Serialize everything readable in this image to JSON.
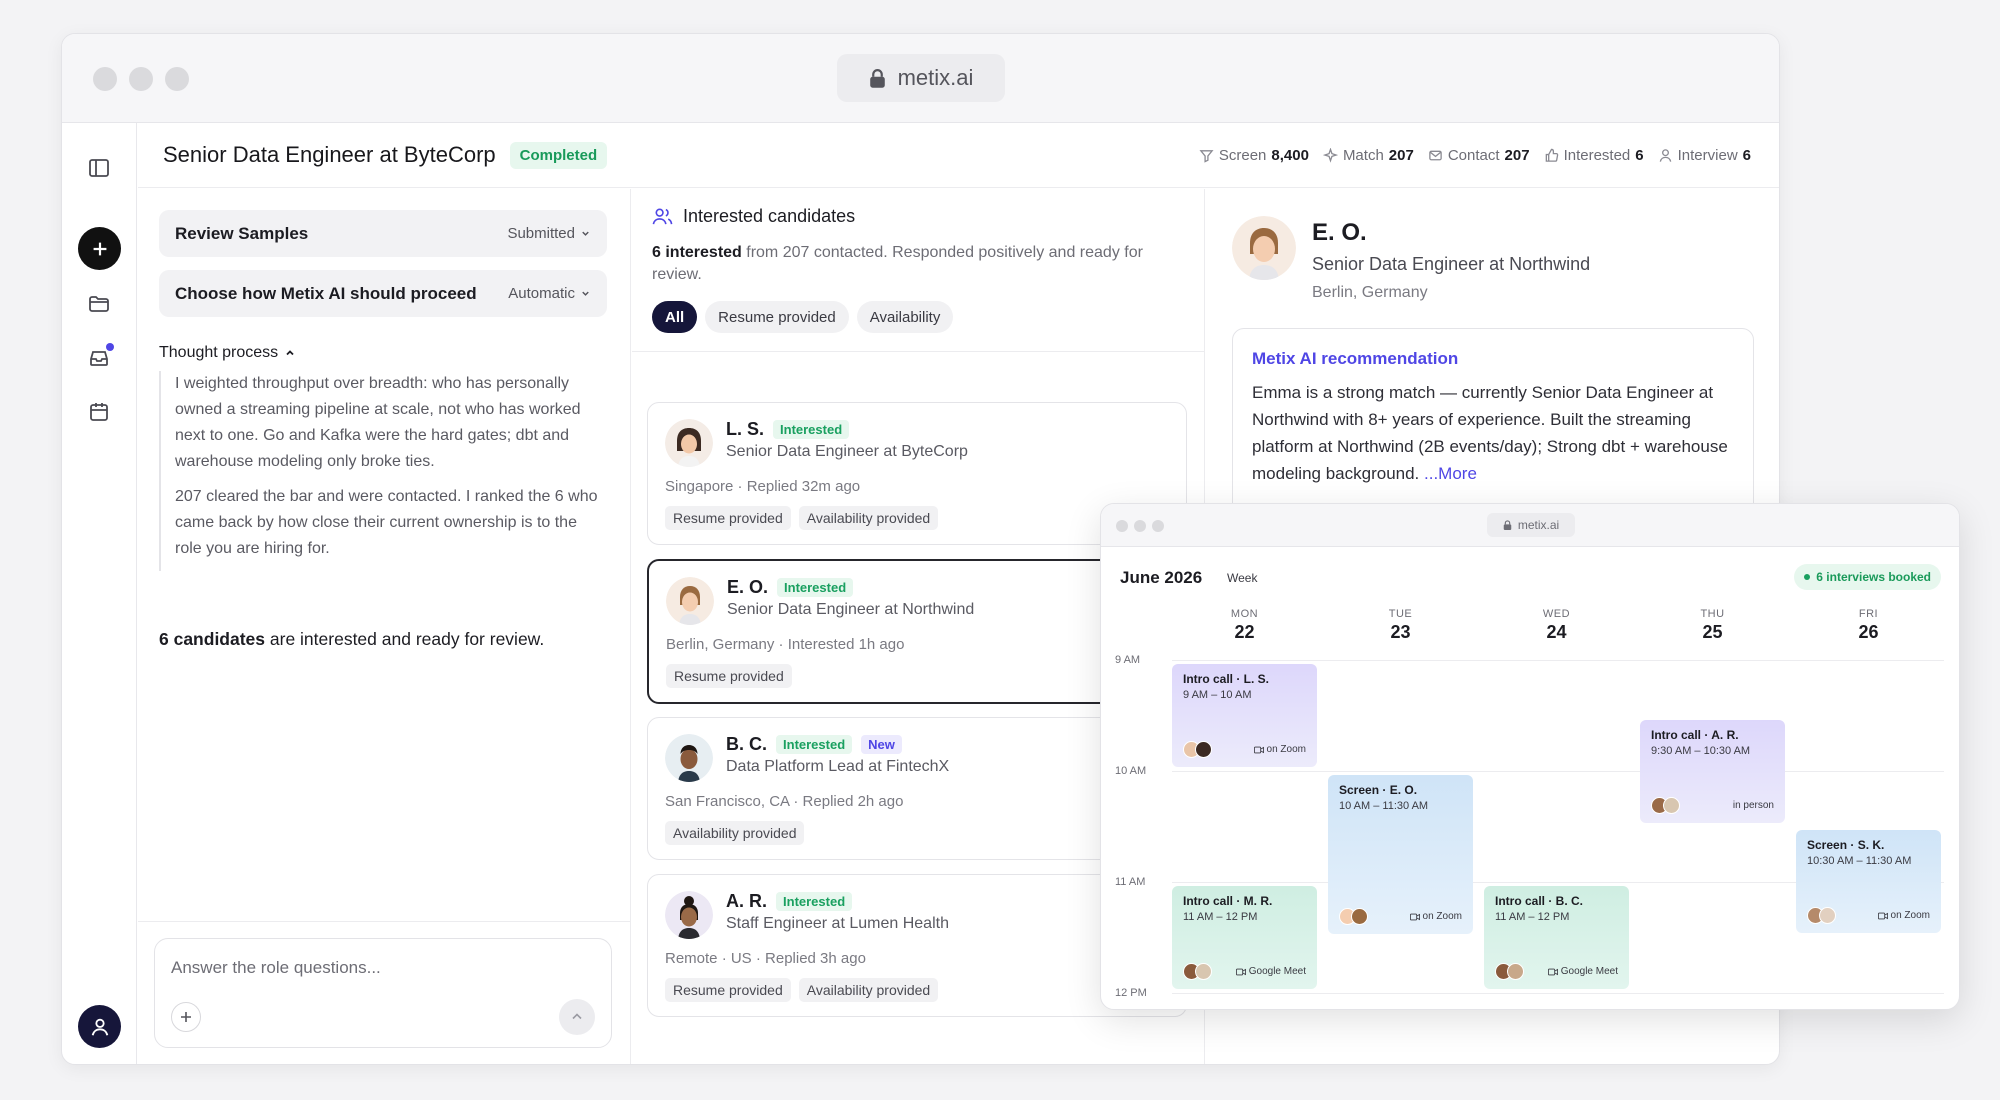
{
  "browser": {
    "url": "metix.ai"
  },
  "header": {
    "role_title": "Senior Data Engineer at ByteCorp",
    "status": "Completed",
    "stats": [
      {
        "label": "Screen",
        "value": "8,400",
        "icon": "filter-icon"
      },
      {
        "label": "Match",
        "value": "207",
        "icon": "sparkle-icon"
      },
      {
        "label": "Contact",
        "value": "207",
        "icon": "mail-icon"
      },
      {
        "label": "Interested",
        "value": "6",
        "icon": "thumbs-up-icon"
      },
      {
        "label": "Interview",
        "value": "6",
        "icon": "person-icon"
      }
    ]
  },
  "left": {
    "review": {
      "label": "Review Samples",
      "value": "Submitted"
    },
    "proceed": {
      "label": "Choose how Metix AI should proceed",
      "value": "Automatic"
    },
    "thought_label": "Thought process",
    "thought_p1": "I weighted throughput over breadth: who has personally owned a streaming pipeline at scale, not who has worked next to one. Go and Kafka were the hard gates; dbt and warehouse modeling only broke ties.",
    "thought_p2": "207 cleared the bar and were contacted. I ranked the 6 who came back by how close their current ownership is to the role you are hiring for.",
    "summary_bold": "6 candidates",
    "summary_rest": " are interested and ready for review.",
    "answer_placeholder": "Answer the role questions..."
  },
  "middle": {
    "heading": "Interested candidates",
    "sub_bold": "6 interested",
    "sub_rest": " from 207 contacted. Responded positively and ready for review.",
    "filters": [
      "All",
      "Resume provided",
      "Availability"
    ],
    "candidates": [
      {
        "name": "L. S.",
        "tag": "Interested",
        "title": "Senior Data Engineer at ByteCorp",
        "meta": "Singapore · Replied 32m ago",
        "chips": [
          "Resume provided",
          "Availability provided"
        ]
      },
      {
        "name": "E. O.",
        "tag": "Interested",
        "title": "Senior Data Engineer at Northwind",
        "meta": "Berlin, Germany · Interested 1h ago",
        "chips": [
          "Resume provided"
        ]
      },
      {
        "name": "B. C.",
        "tag": "Interested",
        "tag2": "New",
        "title": "Data Platform Lead at FintechX",
        "meta": "San Francisco, CA · Replied 2h ago",
        "chips": [
          "Availability provided"
        ]
      },
      {
        "name": "A. R.",
        "tag": "Interested",
        "title": "Staff Engineer at Lumen Health",
        "meta": "Remote · US · Replied 3h ago",
        "chips": [
          "Resume provided",
          "Availability provided"
        ]
      }
    ]
  },
  "profile": {
    "name": "E. O.",
    "title": "Senior Data Engineer at Northwind",
    "location": "Berlin, Germany",
    "rec_heading": "Metix AI recommendation",
    "rec_text": "Emma is a strong match — currently Senior Data Engineer at Northwind with 8+ years of experience. Built the streaming platform at Northwind (2B events/day); Strong dbt + warehouse modeling background. ",
    "rec_more": "...More"
  },
  "calendar": {
    "url": "metix.ai",
    "month": "June 2026",
    "view": "Week",
    "booked": "6 interviews booked",
    "days": [
      {
        "name": "MON",
        "date": "22"
      },
      {
        "name": "TUE",
        "date": "23"
      },
      {
        "name": "WED",
        "date": "24"
      },
      {
        "name": "THU",
        "date": "25"
      },
      {
        "name": "FRI",
        "date": "26"
      }
    ],
    "times": [
      "9 AM",
      "10 AM",
      "11 AM",
      "12 PM"
    ],
    "events": [
      {
        "title": "Intro call · L. S.",
        "time": "9 AM – 10 AM",
        "loc": "on Zoom"
      },
      {
        "title": "Screen · E. O.",
        "time": "10 AM – 11:30 AM",
        "loc": "on Zoom"
      },
      {
        "title": "Intro call · A. R.",
        "time": "9:30 AM – 10:30 AM",
        "loc": "in person"
      },
      {
        "title": "Screen · S. K.",
        "time": "10:30 AM – 11:30 AM",
        "loc": "on Zoom"
      },
      {
        "title": "Intro call · M. R.",
        "time": "11 AM – 12 PM",
        "loc": "Google Meet"
      },
      {
        "title": "Intro call · B. C.",
        "time": "11 AM – 12 PM",
        "loc": "Google Meet"
      }
    ]
  },
  "colors": {
    "accent": "#4f46e5",
    "success": "#1aa060",
    "dark": "#15163a"
  }
}
